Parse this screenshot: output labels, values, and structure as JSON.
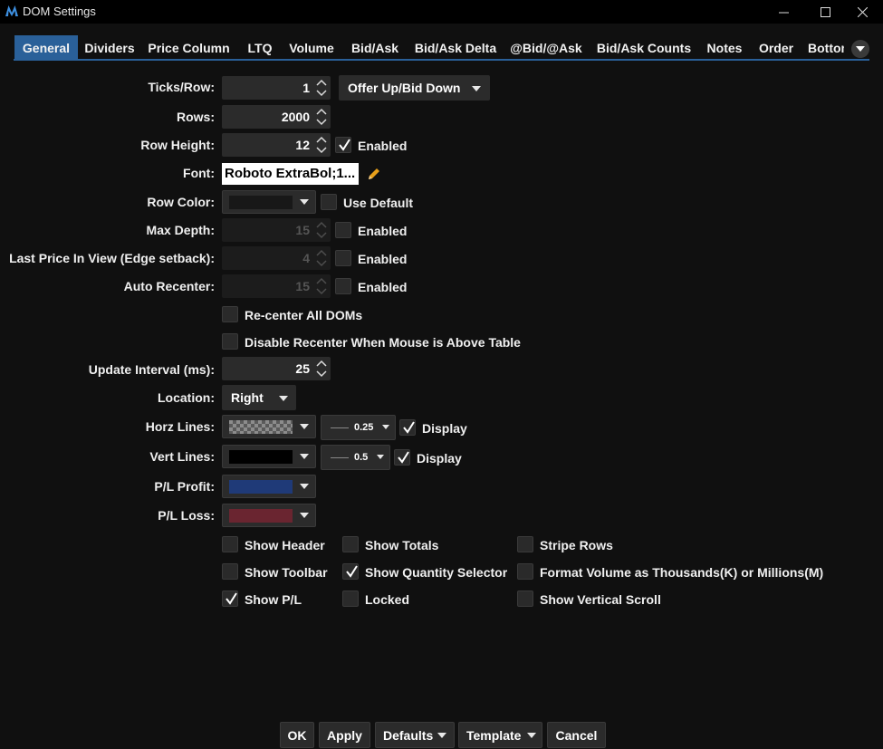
{
  "window": {
    "title": "DOM Settings",
    "logo_icon": "app-logo-icon",
    "controls": [
      "minimize-icon",
      "maximize-icon",
      "close-icon"
    ]
  },
  "tabs": [
    {
      "label": "General",
      "active": true
    },
    {
      "label": "Dividers"
    },
    {
      "label": "Price Column"
    },
    {
      "label": "LTQ"
    },
    {
      "label": "Volume"
    },
    {
      "label": "Bid/Ask"
    },
    {
      "label": "Bid/Ask Delta"
    },
    {
      "label": "@Bid/@Ask"
    },
    {
      "label": "Bid/Ask Counts"
    },
    {
      "label": "Notes"
    },
    {
      "label": "Order"
    },
    {
      "label": "Bottom"
    }
  ],
  "accent_color": "#2a6099",
  "general": {
    "ticks_row": {
      "label": "Ticks/Row:",
      "value": "1",
      "direction": "Offer Up/Bid Down"
    },
    "rows": {
      "label": "Rows:",
      "value": "2000"
    },
    "row_height": {
      "label": "Row Height:",
      "value": "12",
      "enabled_label": "Enabled",
      "enabled": true
    },
    "font": {
      "label": "Font:",
      "value": "Roboto ExtraBol;1..."
    },
    "row_color": {
      "label": "Row Color:",
      "use_default_label": "Use Default",
      "use_default": false,
      "color": "#181818"
    },
    "max_depth": {
      "label": "Max Depth:",
      "value": "15",
      "enabled_label": "Enabled",
      "enabled": false
    },
    "last_price_in_view": {
      "label": "Last Price In View (Edge setback):",
      "value": "4",
      "enabled_label": "Enabled",
      "enabled": false
    },
    "auto_recenter": {
      "label": "Auto Recenter:",
      "value": "15",
      "enabled_label": "Enabled",
      "enabled": false
    },
    "recenter_all": {
      "label": "Re-center All DOMs",
      "checked": false
    },
    "disable_recenter": {
      "label": "Disable Recenter When Mouse is Above Table",
      "checked": false
    },
    "update_interval": {
      "label": "Update Interval (ms):",
      "value": "25"
    },
    "location": {
      "label": "Location:",
      "value": "Right"
    },
    "horz_lines": {
      "label": "Horz Lines:",
      "width": "0.25",
      "display_label": "Display",
      "display": true,
      "color": "checkered"
    },
    "vert_lines": {
      "label": "Vert Lines:",
      "width": "0.5",
      "display_label": "Display",
      "display": true,
      "color": "#000000"
    },
    "pl_profit": {
      "label": "P/L Profit:",
      "color": "#1f3a78"
    },
    "pl_loss": {
      "label": "P/L Loss:",
      "color": "#6a2530"
    }
  },
  "options": [
    {
      "label": "Show Header",
      "checked": false
    },
    {
      "label": "Show Totals",
      "checked": false
    },
    {
      "label": "Stripe Rows",
      "checked": false
    },
    {
      "label": "Show Toolbar",
      "checked": false
    },
    {
      "label": "Show Quantity Selector",
      "checked": true
    },
    {
      "label": "Format Volume as Thousands(K) or Millions(M)",
      "checked": false
    },
    {
      "label": "Show P/L",
      "checked": true
    },
    {
      "label": "Locked",
      "checked": false
    },
    {
      "label": "Show Vertical Scroll",
      "checked": false
    }
  ],
  "buttons": {
    "ok": "OK",
    "apply": "Apply",
    "defaults": "Defaults",
    "template": "Template",
    "cancel": "Cancel"
  }
}
